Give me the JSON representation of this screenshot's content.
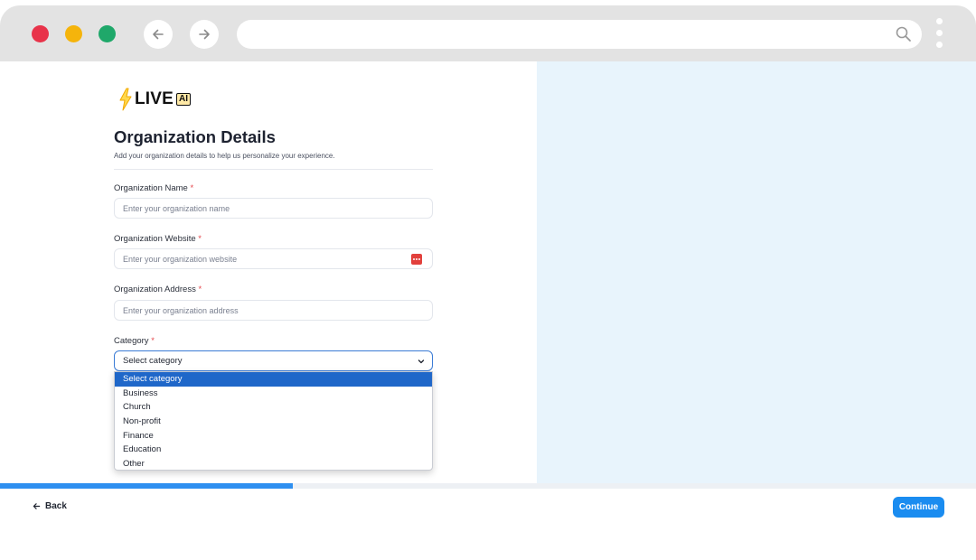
{
  "brand": {
    "name": "LIVE",
    "badge": "AI"
  },
  "page": {
    "title": "Organization Details",
    "subtitle": "Add your organization details to help us personalize your experience."
  },
  "form": {
    "required_mark": "*",
    "org_name": {
      "label": "Organization Name",
      "placeholder": "Enter your organization name",
      "value": ""
    },
    "org_website": {
      "label": "Organization Website",
      "placeholder": "Enter your organization website",
      "value": ""
    },
    "org_address": {
      "label": "Organization Address",
      "placeholder": "Enter your organization address",
      "value": ""
    },
    "category": {
      "label": "Category",
      "selected": "Select category",
      "options": [
        "Select category",
        "Business",
        "Church",
        "Non-profit",
        "Finance",
        "Education",
        "Other"
      ]
    }
  },
  "progress": {
    "fraction": 0.3
  },
  "footer": {
    "back_label": "Back",
    "continue_label": "Continue"
  },
  "colors": {
    "accent": "#1a8cf0",
    "progress": "#2e8ff0",
    "side_panel": "#e8f4fc",
    "required": "#e5484d"
  },
  "icons": [
    "arrow-left-icon",
    "arrow-right-icon",
    "search-icon",
    "more-vertical-icon",
    "bolt-icon",
    "password-manager-icon",
    "chevron-down-icon"
  ]
}
